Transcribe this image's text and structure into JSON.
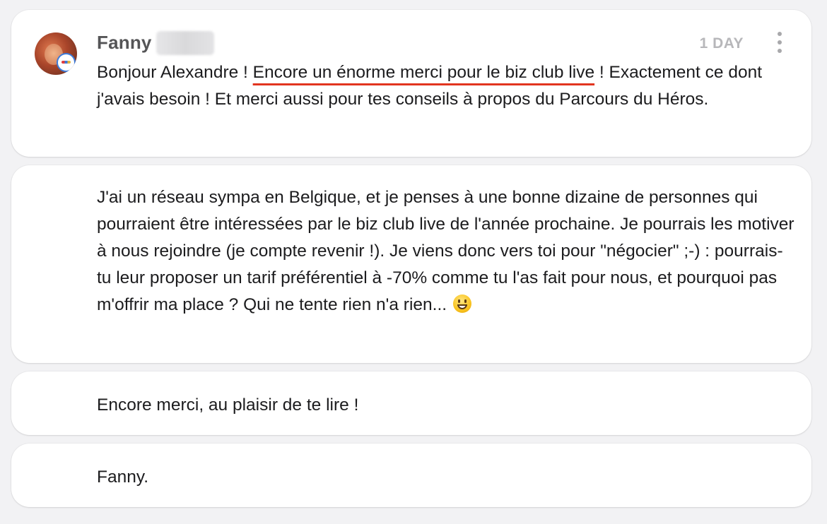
{
  "message": {
    "author": "Fanny",
    "timestamp": "1 DAY",
    "body": {
      "part1_before": "Bonjour Alexandre ! ",
      "part1_highlight": "Encore un énorme merci pour le biz club live",
      "part1_after": " ! Exactement ce dont j'avais besoin ! Et merci aussi pour tes conseils à propos du Parcours du Héros.",
      "part2": "J'ai un réseau sympa en Belgique, et je penses à une bonne dizaine de personnes qui pourraient être intéressées par le biz club live de l'année prochaine. Je pourrais les motiver à nous rejoindre (je compte revenir !). Je viens donc vers toi pour \"négocier\" ;-) : pourrais-tu leur proposer un tarif préférentiel à -70% comme tu l'as fait pour nous, et pourquoi pas m'offrir ma place ? Qui ne tente rien n'a rien... ",
      "part3": "Encore merci, au plaisir de te lire !",
      "part4": "Fanny."
    },
    "icons": {
      "menu": "more-vertical-icon",
      "emoji": "grinning-face-emoji"
    },
    "colors": {
      "highlight_underline": "#e2351f",
      "timestamp": "#b7b7ba"
    }
  }
}
